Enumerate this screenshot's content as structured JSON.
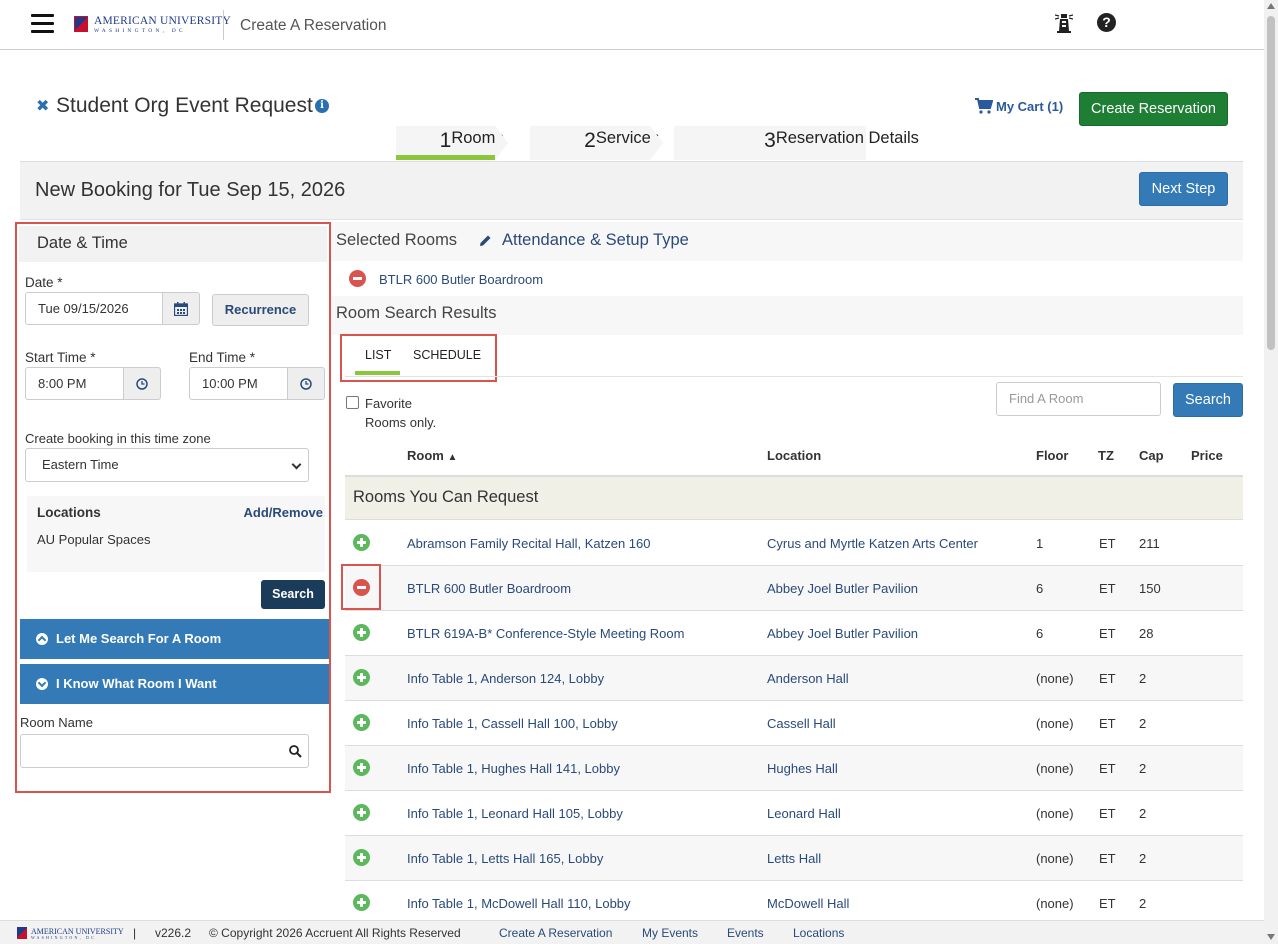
{
  "header": {
    "logo_text": "AMERICAN UNIVERSITY",
    "logo_sub": "WASHINGTON, DC",
    "app_title": "Create A Reservation"
  },
  "page": {
    "title": "Student Org Event Request",
    "cart_label": "My Cart (1)",
    "create_button": "Create Reservation"
  },
  "steps": [
    {
      "num": "1",
      "label": "Rooms"
    },
    {
      "num": "2",
      "label": "Services"
    },
    {
      "num": "3",
      "label": "Reservation Details"
    }
  ],
  "booking": {
    "title": "New Booking for Tue Sep 15, 2026",
    "next_button": "Next Step"
  },
  "left_panel": {
    "header": "Date & Time",
    "date_label": "Date *",
    "date_value": "Tue 09/15/2026",
    "recurrence": "Recurrence",
    "start_label": "Start Time *",
    "start_value": "8:00 PM",
    "end_label": "End Time *",
    "end_value": "10:00 PM",
    "tz_label": "Create booking in this time zone",
    "tz_value": "Eastern Time",
    "locations_title": "Locations",
    "add_remove": "Add/Remove",
    "locations_value": "AU Popular Spaces",
    "search_button": "Search",
    "acc_search": "Let Me Search For A Room",
    "acc_know": "I Know What Room I Want",
    "room_name_label": "Room Name"
  },
  "selected": {
    "title": "Selected Rooms",
    "attendance": "Attendance & Setup Type",
    "room": "BTLR 600 Butler Boardroom"
  },
  "results": {
    "title": "Room Search Results",
    "tab_list": "LIST",
    "tab_schedule": "SCHEDULE",
    "favorite_label": "Favorite Rooms only.",
    "find_placeholder": "Find A Room",
    "search_button": "Search",
    "group_title": "Rooms You Can Request"
  },
  "table": {
    "columns": {
      "room": "Room",
      "location": "Location",
      "floor": "Floor",
      "tz": "TZ",
      "cap": "Cap",
      "price": "Price"
    },
    "rows": [
      {
        "action": "add",
        "room": "Abramson Family Recital Hall, Katzen 160",
        "location": "Cyrus and Myrtle Katzen Arts Center",
        "floor": "1",
        "tz": "ET",
        "cap": "211"
      },
      {
        "action": "remove",
        "room": "BTLR 600 Butler Boardroom",
        "location": "Abbey Joel Butler Pavilion",
        "floor": "6",
        "tz": "ET",
        "cap": "150"
      },
      {
        "action": "add",
        "room": "BTLR 619A-B* Conference-Style Meeting Room",
        "location": "Abbey Joel Butler Pavilion",
        "floor": "6",
        "tz": "ET",
        "cap": "28"
      },
      {
        "action": "add",
        "room": "Info Table 1, Anderson 124, Lobby",
        "location": "Anderson Hall",
        "floor": "(none)",
        "tz": "ET",
        "cap": "2"
      },
      {
        "action": "add",
        "room": "Info Table 1, Cassell Hall 100, Lobby",
        "location": "Cassell Hall",
        "floor": "(none)",
        "tz": "ET",
        "cap": "2"
      },
      {
        "action": "add",
        "room": "Info Table 1, Hughes Hall 141, Lobby",
        "location": "Hughes Hall",
        "floor": "(none)",
        "tz": "ET",
        "cap": "2"
      },
      {
        "action": "add",
        "room": "Info Table 1, Leonard Hall 105, Lobby",
        "location": "Leonard Hall",
        "floor": "(none)",
        "tz": "ET",
        "cap": "2"
      },
      {
        "action": "add",
        "room": "Info Table 1, Letts Hall 165, Lobby",
        "location": "Letts Hall",
        "floor": "(none)",
        "tz": "ET",
        "cap": "2"
      },
      {
        "action": "add",
        "room": "Info Table 1, McDowell Hall 110, Lobby",
        "location": "McDowell Hall",
        "floor": "(none)",
        "tz": "ET",
        "cap": "2"
      }
    ]
  },
  "footer": {
    "separator": "|",
    "version": "v226.2",
    "copyright": "© Copyright 2026 Accruent All Rights Reserved",
    "links": [
      "Create A Reservation",
      "My Events",
      "Events",
      "Locations"
    ]
  },
  "colors": {
    "primary": "#337ab7",
    "success": "#1e7e34",
    "danger": "#d9534f",
    "add": "#5cb85c",
    "step_active": "#8cc63f"
  }
}
